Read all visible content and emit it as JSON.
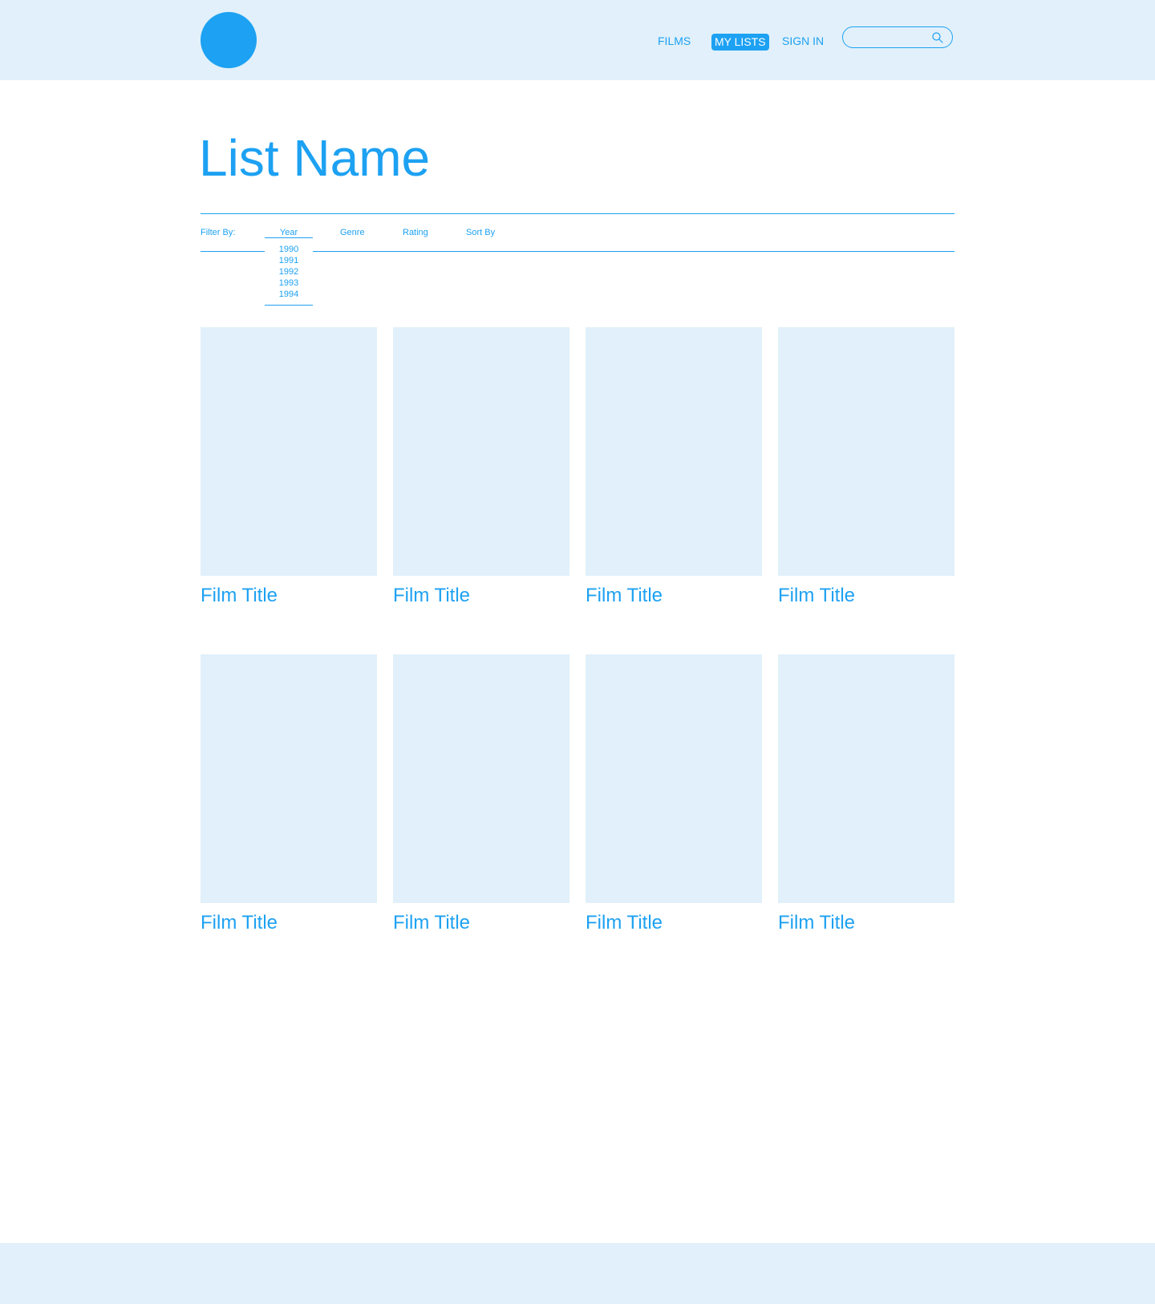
{
  "colors": {
    "accent": "#1da1f2",
    "panel": "#e1f0fa",
    "background": "#ffffff"
  },
  "header": {
    "logo_icon": "circle-logo",
    "nav": {
      "films": "FILMS",
      "my_lists": "MY LISTS",
      "sign_in": "SIGN IN"
    },
    "search": {
      "value": "",
      "icon": "search-icon"
    }
  },
  "page": {
    "title": "List Name"
  },
  "filters": {
    "label": "Filter By:",
    "year": {
      "label": "Year",
      "options": [
        "1990",
        "1991",
        "1992",
        "1993",
        "1994"
      ]
    },
    "genre": "Genre",
    "rating": "Rating",
    "sort": "Sort By"
  },
  "films": [
    {
      "title": "Film Title"
    },
    {
      "title": "Film Title"
    },
    {
      "title": "Film Title"
    },
    {
      "title": "Film Title"
    },
    {
      "title": "Film Title"
    },
    {
      "title": "Film Title"
    },
    {
      "title": "Film Title"
    },
    {
      "title": "Film Title"
    }
  ]
}
